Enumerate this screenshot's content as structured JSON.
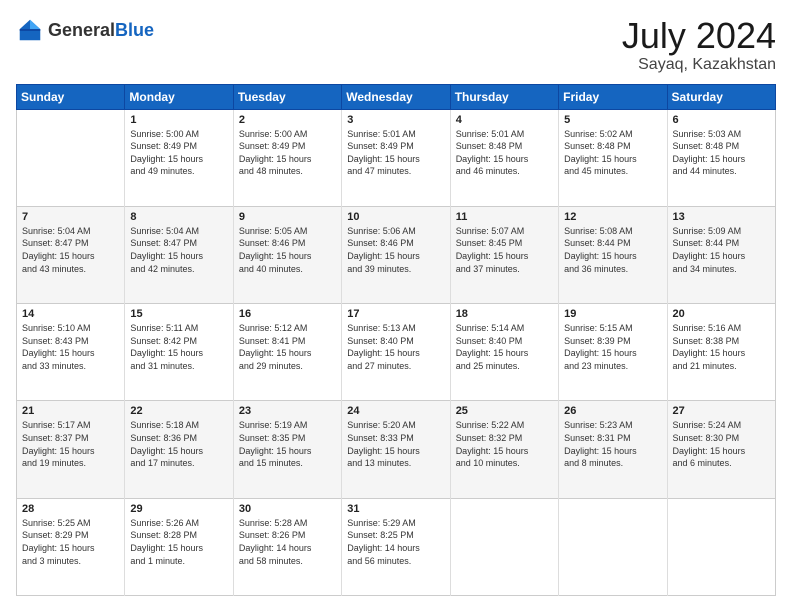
{
  "header": {
    "logo": {
      "general": "General",
      "blue": "Blue"
    },
    "title": "July 2024",
    "location": "Sayaq, Kazakhstan"
  },
  "calendar": {
    "days": [
      "Sunday",
      "Monday",
      "Tuesday",
      "Wednesday",
      "Thursday",
      "Friday",
      "Saturday"
    ],
    "weeks": [
      [
        {
          "day": "",
          "info": ""
        },
        {
          "day": "1",
          "info": "Sunrise: 5:00 AM\nSunset: 8:49 PM\nDaylight: 15 hours\nand 49 minutes."
        },
        {
          "day": "2",
          "info": "Sunrise: 5:00 AM\nSunset: 8:49 PM\nDaylight: 15 hours\nand 48 minutes."
        },
        {
          "day": "3",
          "info": "Sunrise: 5:01 AM\nSunset: 8:49 PM\nDaylight: 15 hours\nand 47 minutes."
        },
        {
          "day": "4",
          "info": "Sunrise: 5:01 AM\nSunset: 8:48 PM\nDaylight: 15 hours\nand 46 minutes."
        },
        {
          "day": "5",
          "info": "Sunrise: 5:02 AM\nSunset: 8:48 PM\nDaylight: 15 hours\nand 45 minutes."
        },
        {
          "day": "6",
          "info": "Sunrise: 5:03 AM\nSunset: 8:48 PM\nDaylight: 15 hours\nand 44 minutes."
        }
      ],
      [
        {
          "day": "7",
          "info": "Sunrise: 5:04 AM\nSunset: 8:47 PM\nDaylight: 15 hours\nand 43 minutes."
        },
        {
          "day": "8",
          "info": "Sunrise: 5:04 AM\nSunset: 8:47 PM\nDaylight: 15 hours\nand 42 minutes."
        },
        {
          "day": "9",
          "info": "Sunrise: 5:05 AM\nSunset: 8:46 PM\nDaylight: 15 hours\nand 40 minutes."
        },
        {
          "day": "10",
          "info": "Sunrise: 5:06 AM\nSunset: 8:46 PM\nDaylight: 15 hours\nand 39 minutes."
        },
        {
          "day": "11",
          "info": "Sunrise: 5:07 AM\nSunset: 8:45 PM\nDaylight: 15 hours\nand 37 minutes."
        },
        {
          "day": "12",
          "info": "Sunrise: 5:08 AM\nSunset: 8:44 PM\nDaylight: 15 hours\nand 36 minutes."
        },
        {
          "day": "13",
          "info": "Sunrise: 5:09 AM\nSunset: 8:44 PM\nDaylight: 15 hours\nand 34 minutes."
        }
      ],
      [
        {
          "day": "14",
          "info": "Sunrise: 5:10 AM\nSunset: 8:43 PM\nDaylight: 15 hours\nand 33 minutes."
        },
        {
          "day": "15",
          "info": "Sunrise: 5:11 AM\nSunset: 8:42 PM\nDaylight: 15 hours\nand 31 minutes."
        },
        {
          "day": "16",
          "info": "Sunrise: 5:12 AM\nSunset: 8:41 PM\nDaylight: 15 hours\nand 29 minutes."
        },
        {
          "day": "17",
          "info": "Sunrise: 5:13 AM\nSunset: 8:40 PM\nDaylight: 15 hours\nand 27 minutes."
        },
        {
          "day": "18",
          "info": "Sunrise: 5:14 AM\nSunset: 8:40 PM\nDaylight: 15 hours\nand 25 minutes."
        },
        {
          "day": "19",
          "info": "Sunrise: 5:15 AM\nSunset: 8:39 PM\nDaylight: 15 hours\nand 23 minutes."
        },
        {
          "day": "20",
          "info": "Sunrise: 5:16 AM\nSunset: 8:38 PM\nDaylight: 15 hours\nand 21 minutes."
        }
      ],
      [
        {
          "day": "21",
          "info": "Sunrise: 5:17 AM\nSunset: 8:37 PM\nDaylight: 15 hours\nand 19 minutes."
        },
        {
          "day": "22",
          "info": "Sunrise: 5:18 AM\nSunset: 8:36 PM\nDaylight: 15 hours\nand 17 minutes."
        },
        {
          "day": "23",
          "info": "Sunrise: 5:19 AM\nSunset: 8:35 PM\nDaylight: 15 hours\nand 15 minutes."
        },
        {
          "day": "24",
          "info": "Sunrise: 5:20 AM\nSunset: 8:33 PM\nDaylight: 15 hours\nand 13 minutes."
        },
        {
          "day": "25",
          "info": "Sunrise: 5:22 AM\nSunset: 8:32 PM\nDaylight: 15 hours\nand 10 minutes."
        },
        {
          "day": "26",
          "info": "Sunrise: 5:23 AM\nSunset: 8:31 PM\nDaylight: 15 hours\nand 8 minutes."
        },
        {
          "day": "27",
          "info": "Sunrise: 5:24 AM\nSunset: 8:30 PM\nDaylight: 15 hours\nand 6 minutes."
        }
      ],
      [
        {
          "day": "28",
          "info": "Sunrise: 5:25 AM\nSunset: 8:29 PM\nDaylight: 15 hours\nand 3 minutes."
        },
        {
          "day": "29",
          "info": "Sunrise: 5:26 AM\nSunset: 8:28 PM\nDaylight: 15 hours\nand 1 minute."
        },
        {
          "day": "30",
          "info": "Sunrise: 5:28 AM\nSunset: 8:26 PM\nDaylight: 14 hours\nand 58 minutes."
        },
        {
          "day": "31",
          "info": "Sunrise: 5:29 AM\nSunset: 8:25 PM\nDaylight: 14 hours\nand 56 minutes."
        },
        {
          "day": "",
          "info": ""
        },
        {
          "day": "",
          "info": ""
        },
        {
          "day": "",
          "info": ""
        }
      ]
    ]
  }
}
